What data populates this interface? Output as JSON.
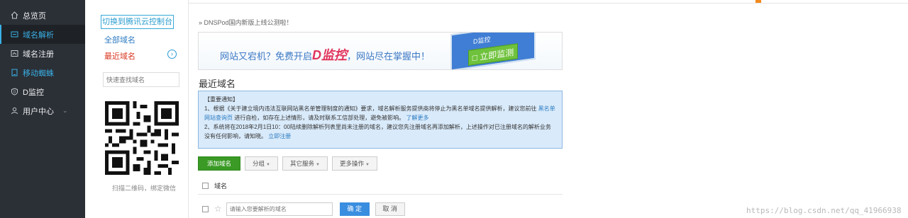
{
  "nav": {
    "items": [
      {
        "label": "总览页",
        "icon": "home-icon"
      },
      {
        "label": "域名解析",
        "icon": "dns-icon"
      },
      {
        "label": "域名注册",
        "icon": "register-icon"
      },
      {
        "label": "移动蜘蛛",
        "icon": "mobile-icon"
      },
      {
        "label": "D监控",
        "icon": "shield-icon"
      },
      {
        "label": "用户中心",
        "icon": "user-icon"
      }
    ]
  },
  "subnav": {
    "switch_label": "切换到腾讯云控制台",
    "all_domains": "全部域名",
    "recent_domains": "最近域名",
    "search_placeholder": "快速查找域名",
    "qr_label": "扫描二维码，绑定微信"
  },
  "main": {
    "notice": "» DNSPod国内新版上线公测啦！",
    "banner_text_1": "网站又宕机？免费开启",
    "banner_text_brand": "D监控",
    "banner_text_2": "，网站尽在掌握中！",
    "banner_screen": "D监控",
    "banner_button": "立即监测",
    "section_title": "最近域名",
    "alert": {
      "title": "【重要通知】",
      "line1": "1、根据《关于建立境内违法互联网站黑名单管理制度的通知》要求，域名解析服务提供商将停止为黑名单域名提供解析，建议您前往",
      "line1_link": "黑名单网站查询页",
      "line1_tail": "进行自检，如存在上述情形，请及时联系工信部处理，避免被影响。",
      "line1_more": "了解更多",
      "line2": "2、系统将在2018年2月1日10：00陆续删除解析列表里尚未注册的域名，建议您先注册域名再添加解析，上述操作对已注册域名的解析业务没有任何影响，请知晓。",
      "line2_link": "立即注册"
    },
    "toolbar": {
      "add": "添加域名",
      "group": "分组",
      "other": "其它服务",
      "more": "更多操作"
    },
    "table_header": "域名",
    "input_placeholder": "请输入您要解析的域名",
    "ok": "确 定",
    "cancel": "取 消"
  },
  "watermark": "https://blog.csdn.net/qq_41966938"
}
